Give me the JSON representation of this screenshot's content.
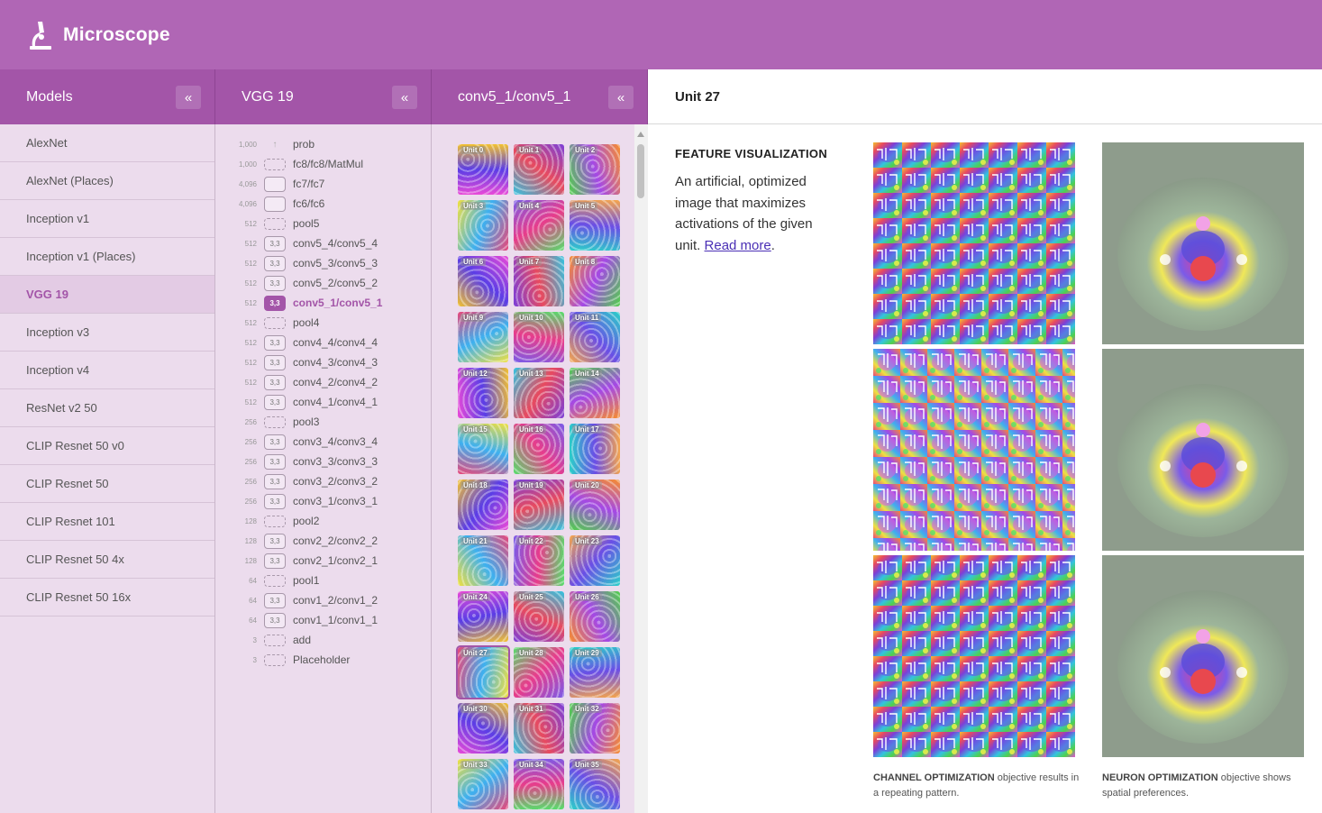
{
  "app": {
    "title": "Microscope"
  },
  "columns": {
    "models_header": "Models",
    "layers_header": "VGG 19",
    "units_header": "conv5_1/conv5_1",
    "detail_header": "Unit 27",
    "collapse_glyph": "«"
  },
  "models": [
    {
      "label": "AlexNet",
      "active": false
    },
    {
      "label": "AlexNet (Places)",
      "active": false
    },
    {
      "label": "Inception v1",
      "active": false
    },
    {
      "label": "Inception v1 (Places)",
      "active": false
    },
    {
      "label": "VGG 19",
      "active": true
    },
    {
      "label": "Inception v3",
      "active": false
    },
    {
      "label": "Inception v4",
      "active": false
    },
    {
      "label": "ResNet v2 50",
      "active": false
    },
    {
      "label": "CLIP Resnet 50 v0",
      "active": false
    },
    {
      "label": "CLIP Resnet 50",
      "active": false
    },
    {
      "label": "CLIP Resnet 101",
      "active": false
    },
    {
      "label": "CLIP Resnet 50 4x",
      "active": false
    },
    {
      "label": "CLIP Resnet 50 16x",
      "active": false
    }
  ],
  "layers": [
    {
      "count": "1,000",
      "kind": "arrow",
      "box": "",
      "name": "prob"
    },
    {
      "count": "1,000",
      "kind": "dashed",
      "box": "",
      "name": "fc8/fc8/MatMul"
    },
    {
      "count": "4,096",
      "kind": "empty",
      "box": "",
      "name": "fc7/fc7"
    },
    {
      "count": "4,096",
      "kind": "empty",
      "box": "",
      "name": "fc6/fc6"
    },
    {
      "count": "512",
      "kind": "dashed",
      "box": "",
      "name": "pool5"
    },
    {
      "count": "512",
      "kind": "conv",
      "box": "3,3",
      "name": "conv5_4/conv5_4"
    },
    {
      "count": "512",
      "kind": "conv",
      "box": "3,3",
      "name": "conv5_3/conv5_3"
    },
    {
      "count": "512",
      "kind": "conv",
      "box": "3,3",
      "name": "conv5_2/conv5_2"
    },
    {
      "count": "512",
      "kind": "active",
      "box": "3,3",
      "name": "conv5_1/conv5_1"
    },
    {
      "count": "512",
      "kind": "dashed",
      "box": "",
      "name": "pool4"
    },
    {
      "count": "512",
      "kind": "conv",
      "box": "3,3",
      "name": "conv4_4/conv4_4"
    },
    {
      "count": "512",
      "kind": "conv",
      "box": "3,3",
      "name": "conv4_3/conv4_3"
    },
    {
      "count": "512",
      "kind": "conv",
      "box": "3,3",
      "name": "conv4_2/conv4_2"
    },
    {
      "count": "512",
      "kind": "conv",
      "box": "3,3",
      "name": "conv4_1/conv4_1"
    },
    {
      "count": "256",
      "kind": "dashed",
      "box": "",
      "name": "pool3"
    },
    {
      "count": "256",
      "kind": "conv",
      "box": "3,3",
      "name": "conv3_4/conv3_4"
    },
    {
      "count": "256",
      "kind": "conv",
      "box": "3,3",
      "name": "conv3_3/conv3_3"
    },
    {
      "count": "256",
      "kind": "conv",
      "box": "3,3",
      "name": "conv3_2/conv3_2"
    },
    {
      "count": "256",
      "kind": "conv",
      "box": "3,3",
      "name": "conv3_1/conv3_1"
    },
    {
      "count": "128",
      "kind": "dashed",
      "box": "",
      "name": "pool2"
    },
    {
      "count": "128",
      "kind": "conv",
      "box": "3,3",
      "name": "conv2_2/conv2_2"
    },
    {
      "count": "128",
      "kind": "conv",
      "box": "3,3",
      "name": "conv2_1/conv2_1"
    },
    {
      "count": "64",
      "kind": "dashed",
      "box": "",
      "name": "pool1"
    },
    {
      "count": "64",
      "kind": "conv",
      "box": "3,3",
      "name": "conv1_2/conv1_2"
    },
    {
      "count": "64",
      "kind": "conv",
      "box": "3,3",
      "name": "conv1_1/conv1_1"
    },
    {
      "count": "3",
      "kind": "dashed",
      "box": "",
      "name": "add"
    },
    {
      "count": "3",
      "kind": "dashed",
      "box": "",
      "name": "Placeholder"
    }
  ],
  "units": [
    "Unit 0",
    "Unit 1",
    "Unit 2",
    "Unit 3",
    "Unit 4",
    "Unit 5",
    "Unit 6",
    "Unit 7",
    "Unit 8",
    "Unit 9",
    "Unit 10",
    "Unit 11",
    "Unit 12",
    "Unit 13",
    "Unit 14",
    "Unit 15",
    "Unit 16",
    "Unit 17",
    "Unit 18",
    "Unit 19",
    "Unit 20",
    "Unit 21",
    "Unit 22",
    "Unit 23",
    "Unit 24",
    "Unit 25",
    "Unit 26",
    "Unit 27",
    "Unit 28",
    "Unit 29",
    "Unit 30",
    "Unit 31",
    "Unit 32",
    "Unit 33",
    "Unit 34",
    "Unit 35"
  ],
  "selected_unit": "Unit 27",
  "feature_visualization": {
    "title": "FEATURE VISUALIZATION",
    "description": "An artificial, optimized image that maximizes activations of the given unit.",
    "read_more": "Read more",
    "period": ".",
    "channel_caption_bold": "CHANNEL OPTIMIZATION",
    "channel_caption_rest": " objective results in a repeating pattern.",
    "neuron_caption_bold": "NEURON OPTIMIZATION",
    "neuron_caption_rest": " objective shows spatial preferences."
  },
  "colors": {
    "topbar": "#b066b5",
    "header": "#a355a8",
    "panel": "#ecdced",
    "accent": "#a355a8",
    "link": "#4a2fb5"
  }
}
